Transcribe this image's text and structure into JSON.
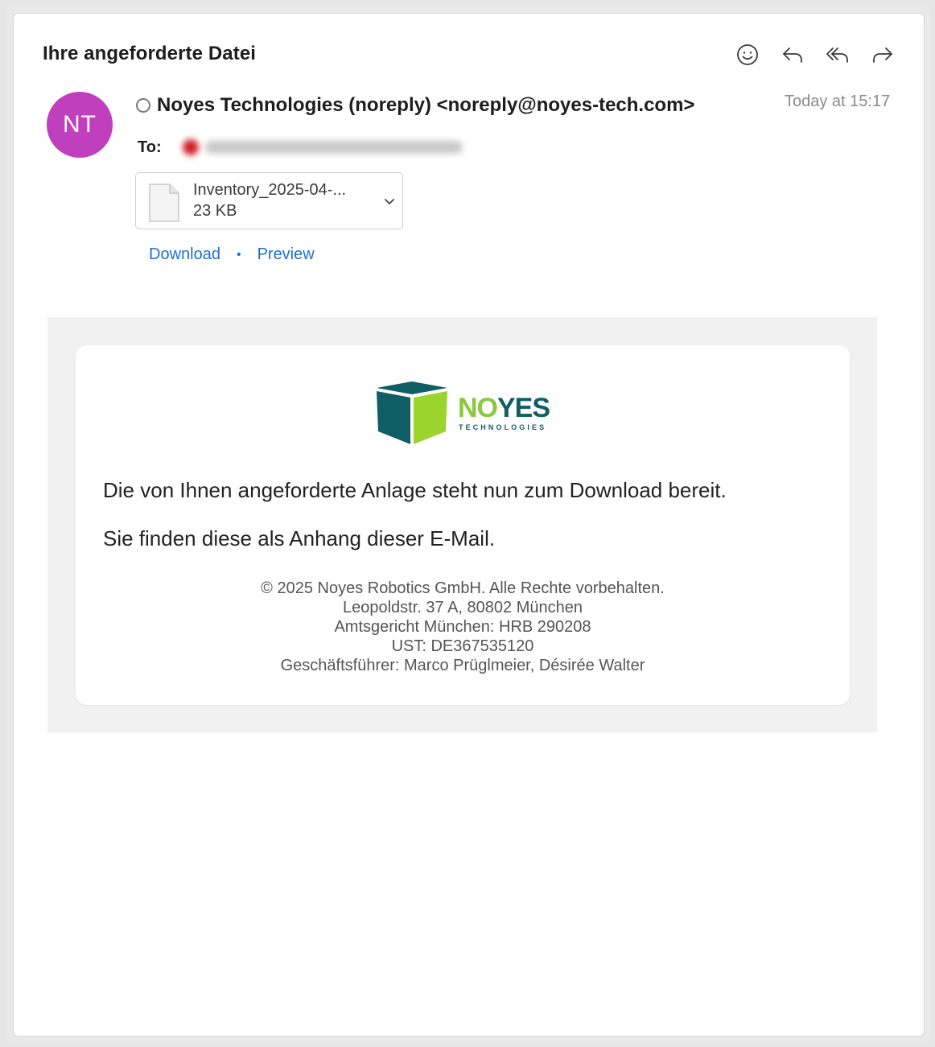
{
  "email": {
    "subject": "Ihre angeforderte Datei",
    "sender": "Noyes Technologies (noreply) <noreply@noyes-tech.com>",
    "sender_initials": "NT",
    "avatar_color": "#c03fbd",
    "to_label": "To:",
    "timestamp": "Today at 15:17"
  },
  "toolbar": {
    "icons": [
      "emoji-reaction-icon",
      "reply-icon",
      "reply-all-icon",
      "forward-icon"
    ]
  },
  "attachment": {
    "name": "Inventory_2025-04-...",
    "size": "23 KB",
    "download_label": "Download",
    "separator": "•",
    "preview_label": "Preview",
    "link_color": "#1f6fd0"
  },
  "body": {
    "logo": {
      "word_part1": "NO",
      "word_part2": "YES",
      "subtitle": "TECHNOLOGIES",
      "colors": {
        "teal": "#0f5e63",
        "green": "#8dc63f"
      }
    },
    "message_line1": "Die von Ihnen angeforderte Anlage steht nun zum Download bereit.",
    "message_line2": "Sie finden diese als Anhang dieser E-Mail.",
    "footer": [
      "© 2025 Noyes Robotics GmbH. Alle Rechte vorbehalten.",
      "Leopoldstr. 37 A, 80802 München",
      "Amtsgericht München: HRB 290208",
      "UST: DE367535120",
      "Geschäftsführer: Marco Prüglmeier, Désirée Walter"
    ]
  }
}
